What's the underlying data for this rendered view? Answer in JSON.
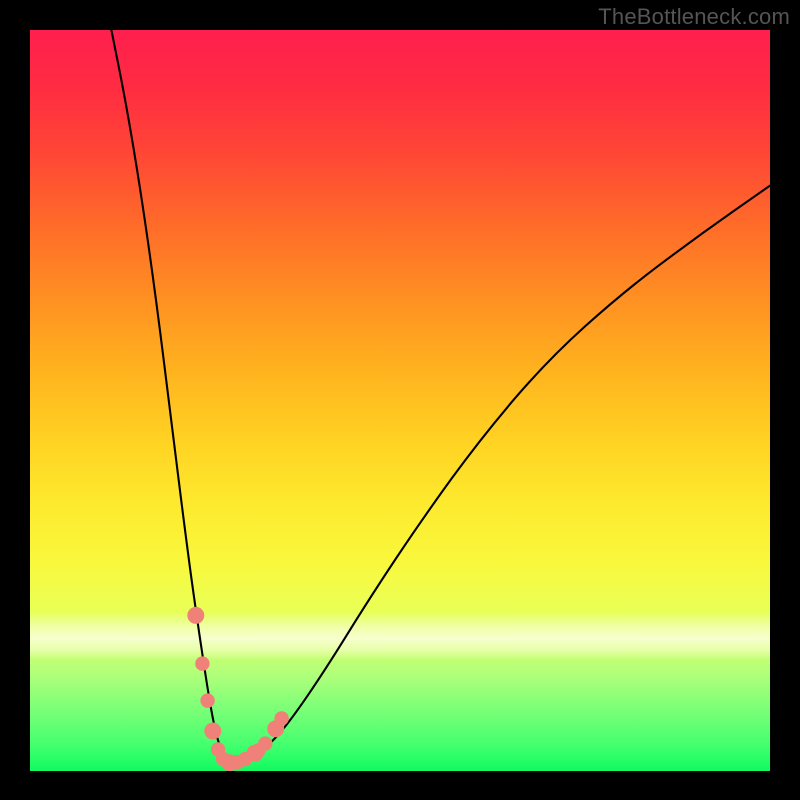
{
  "watermark": "TheBottleneck.com",
  "chart_data": {
    "type": "line",
    "title": "",
    "xlabel": "",
    "ylabel": "",
    "xlim": [
      0,
      100
    ],
    "ylim": [
      0,
      100
    ],
    "grid": false,
    "series": [
      {
        "name": "bottleneck-curve",
        "x": [
          11,
          13,
          15,
          17,
          19,
          21,
          22.5,
          24,
          25,
          25.8,
          26.6,
          27.5,
          28.5,
          30,
          32,
          35,
          40,
          46,
          53,
          61,
          70,
          80,
          90,
          100
        ],
        "y": [
          100,
          90,
          78,
          64,
          48,
          32,
          21,
          11,
          5.5,
          2.8,
          1.5,
          1.1,
          1.2,
          1.8,
          3.2,
          6.5,
          13.8,
          23.5,
          34,
          45,
          55.5,
          64.5,
          72,
          79
        ]
      }
    ],
    "markers": {
      "name": "highlighted-points",
      "color": "#f08178",
      "points": [
        {
          "x": 22.4,
          "y": 21
        },
        {
          "x": 23.3,
          "y": 14.5
        },
        {
          "x": 24.0,
          "y": 9.5
        },
        {
          "x": 24.7,
          "y": 5.4
        },
        {
          "x": 25.4,
          "y": 2.9
        },
        {
          "x": 26.1,
          "y": 1.6
        },
        {
          "x": 27.0,
          "y": 1.1
        },
        {
          "x": 28.0,
          "y": 1.2
        },
        {
          "x": 29.1,
          "y": 1.6
        },
        {
          "x": 30.4,
          "y": 2.4
        },
        {
          "x": 30.9,
          "y": 2.8
        },
        {
          "x": 31.8,
          "y": 3.7
        },
        {
          "x": 33.2,
          "y": 5.7
        },
        {
          "x": 34.0,
          "y": 7.1
        }
      ]
    },
    "gradient_colors": {
      "top": "#ff1f4e",
      "mid_orange": "#ff8f22",
      "mid_yellow": "#fdea2e",
      "bottom": "#12f95f"
    }
  }
}
